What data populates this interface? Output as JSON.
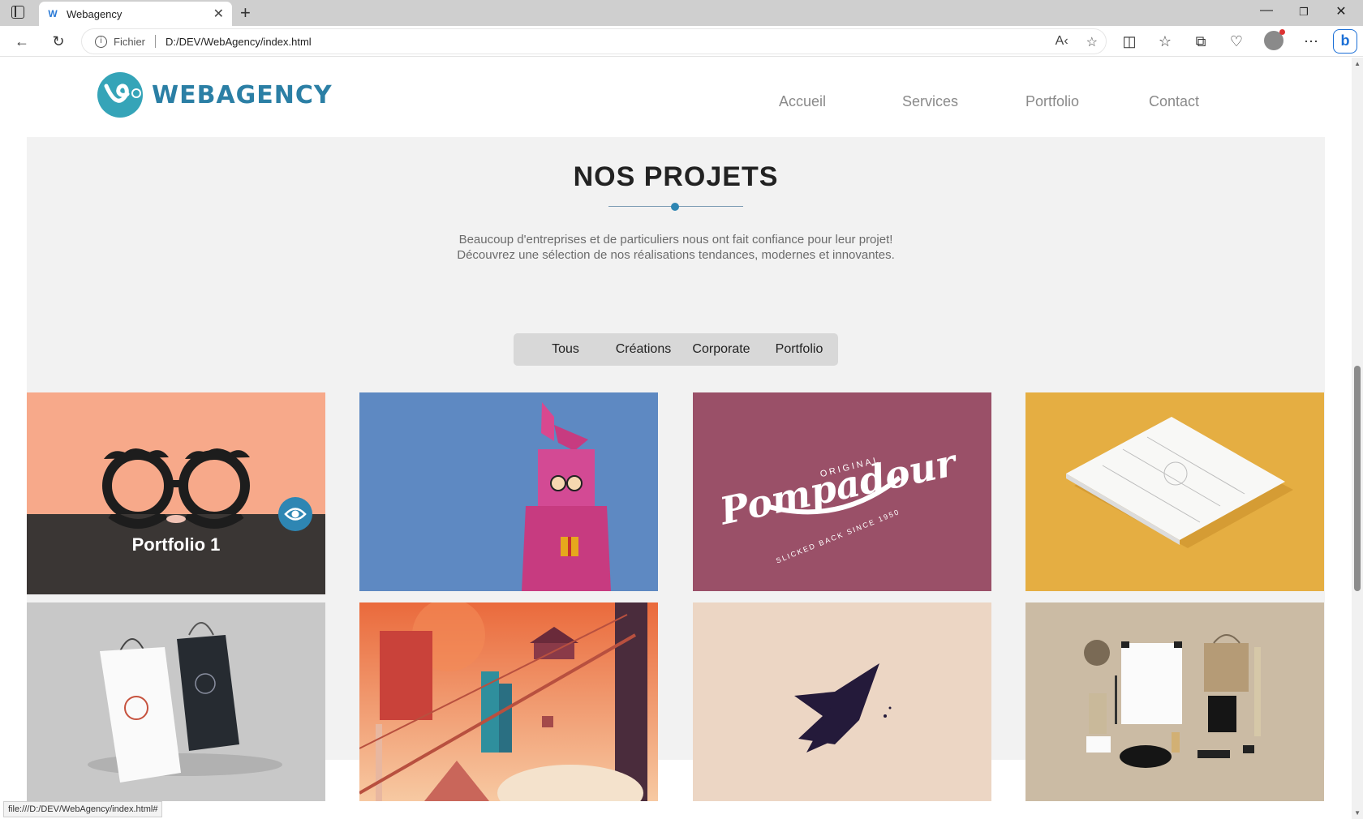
{
  "browser": {
    "tab_title": "Webagency",
    "address_scheme": "Fichier",
    "address_url": "D:/DEV/WebAgency/index.html",
    "status_url": "file:///D:/DEV/WebAgency/index.html#"
  },
  "site": {
    "logo_text": "WEBAGENCY",
    "nav": [
      "Accueil",
      "Services",
      "Portfolio",
      "Contact"
    ]
  },
  "projects": {
    "title": "NOS PROJETS",
    "description_line1": "Beaucoup d'entreprises et de particuliers nous ont fait confiance pour leur projet!",
    "description_line2": "Découvrez une sélection de nos réalisations tendances, modernes et innovantes.",
    "filters": [
      "Tous",
      "Créations",
      "Corporate",
      "Portfolio"
    ],
    "hover_label": "Portfolio 1",
    "tiles": [
      {
        "name": "glasses",
        "color": "#f7a98a"
      },
      {
        "name": "pink-bunny-robot",
        "color": "#5e89c2"
      },
      {
        "name": "pompadour-logo",
        "color": "#9a5068",
        "text_top": "ORIGINAL",
        "text_main": "Pompadour",
        "text_arc": "SLICKED BACK SINCE 1950"
      },
      {
        "name": "paper-mockup",
        "color": "#e5ae42"
      },
      {
        "name": "shopping-bags",
        "color": "#c8c8c8"
      },
      {
        "name": "city-illustration",
        "color": "#f0a25a"
      },
      {
        "name": "rocket-logo",
        "color": "#ecd6c4"
      },
      {
        "name": "stationery",
        "color": "#cbbba4"
      }
    ]
  },
  "colors": {
    "accent": "#2e86b3",
    "logo": "#2b7fa5",
    "section_bg": "#f2f2f2"
  }
}
